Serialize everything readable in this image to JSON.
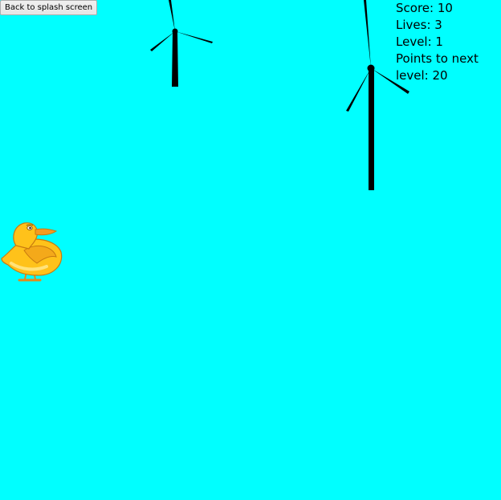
{
  "controls": {
    "back_label": "Back to splash screen"
  },
  "hud": {
    "score_text": "Score: 10",
    "lives_text": "Lives: 3",
    "level_text": "Level: 1",
    "points_line1": "Points to next",
    "points_line2": "level: 20"
  },
  "scene": {
    "background_color": "#00ffff",
    "obstacles": [
      "wind-turbine",
      "wind-turbine"
    ],
    "player_sprite": "duck"
  },
  "colors": {
    "turbine": "#000000",
    "duck_body": "#ffc21a",
    "duck_outline": "#c77a10",
    "duck_beak": "#f59b22"
  }
}
